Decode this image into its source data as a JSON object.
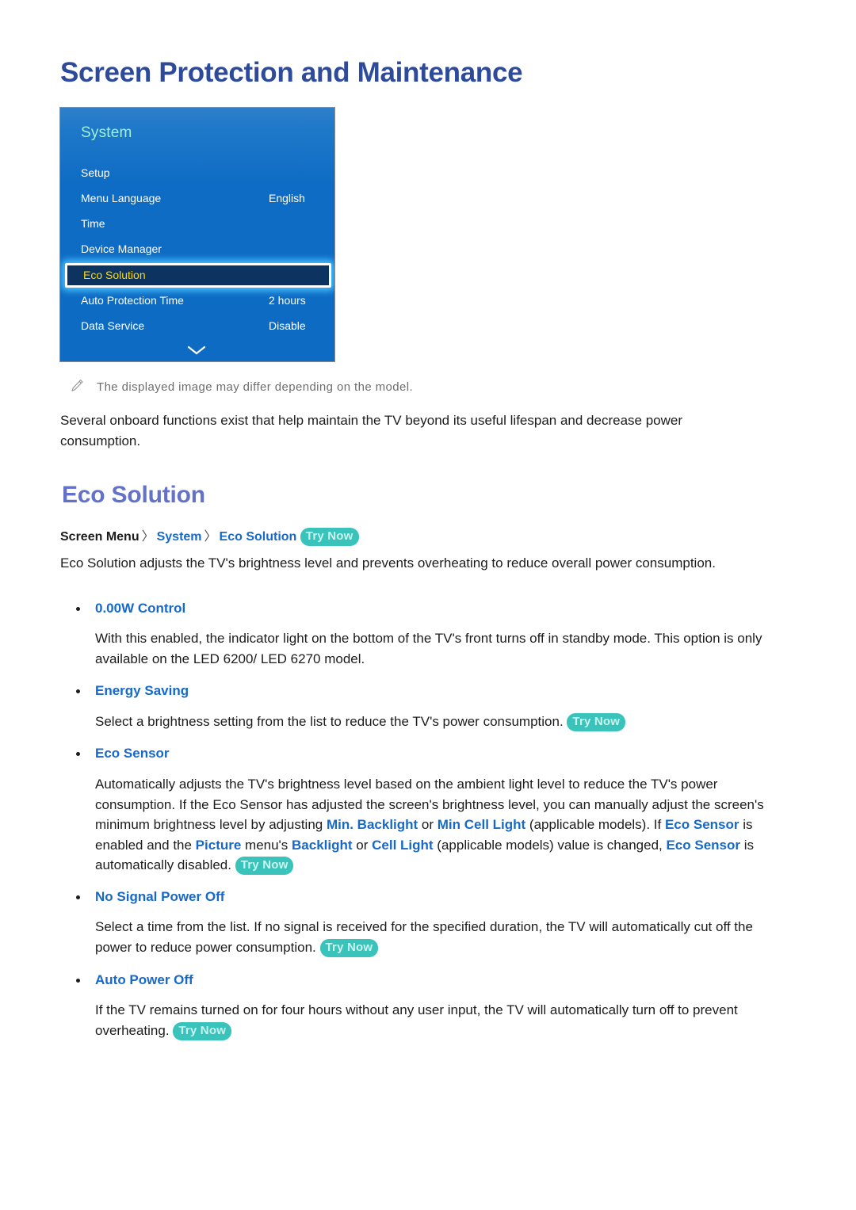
{
  "page_title": "Screen Protection and Maintenance",
  "tv_menu": {
    "header": "System",
    "rows": [
      {
        "label": "Setup",
        "value": ""
      },
      {
        "label": "Menu Language",
        "value": "English"
      },
      {
        "label": "Time",
        "value": ""
      },
      {
        "label": "Device Manager",
        "value": ""
      },
      {
        "label": "Eco Solution",
        "value": "",
        "selected": true
      },
      {
        "label": "Auto Protection Time",
        "value": "2 hours"
      },
      {
        "label": "Data Service",
        "value": "Disable"
      }
    ],
    "scroll_icon": "chevron-down-icon",
    "colors": {
      "panel_blue": "#0d6bc4",
      "header_text": "#9ff0da",
      "selected_fill": "#0d3460",
      "selected_text": "#ffd900",
      "selected_glow": "#49c2ff"
    }
  },
  "note": {
    "icon": "pencil-icon",
    "text": "The displayed image may differ depending on the model."
  },
  "intro_paragraph": "Several onboard functions exist that help maintain the TV beyond its useful lifespan and decrease power consumption.",
  "section": {
    "title": "Eco Solution",
    "breadcrumb": {
      "root": "Screen Menu",
      "separator": "〉",
      "level1": "System",
      "level2": "Eco Solution",
      "badge": "Try Now"
    },
    "description": "Eco Solution adjusts the TV's brightness level and prevents overheating to reduce overall power consumption."
  },
  "features": [
    {
      "title": "0.00W Control",
      "body": "With this enabled, the indicator light on the bottom of the TV's front turns off in standby mode. This option is only available on the LED 6200/ LED 6270 model.",
      "badge": ""
    },
    {
      "title": "Energy Saving",
      "body": "Select a brightness setting from the list to reduce the TV's power consumption.",
      "badge": "Try Now"
    },
    {
      "title": "Eco Sensor",
      "body_parts": [
        {
          "t": "Automatically adjusts the TV's brightness level based on the ambient light level to reduce the TV's power consumption. If the Eco Sensor has adjusted the screen's brightness level, you can manually adjust the screen's minimum brightness level by adjusting ",
          "b": false
        },
        {
          "t": "Min. Backlight",
          "b": true
        },
        {
          "t": " or ",
          "b": false
        },
        {
          "t": "Min Cell Light",
          "b": true
        },
        {
          "t": " (applicable models). If ",
          "b": false
        },
        {
          "t": "Eco Sensor",
          "b": true
        },
        {
          "t": " is enabled and the ",
          "b": false
        },
        {
          "t": "Picture",
          "b": true
        },
        {
          "t": " menu's ",
          "b": false
        },
        {
          "t": "Backlight",
          "b": true
        },
        {
          "t": " or ",
          "b": false
        },
        {
          "t": "Cell Light",
          "b": true
        },
        {
          "t": " (applicable models) value is changed, ",
          "b": false
        },
        {
          "t": "Eco Sensor",
          "b": true
        },
        {
          "t": " is automatically disabled. ",
          "b": false
        }
      ],
      "badge": "Try Now"
    },
    {
      "title": "No Signal Power Off",
      "body": "Select a time from the list. If no signal is received for the specified duration, the TV will automatically cut off the power to reduce power consumption.",
      "badge": "Try Now"
    },
    {
      "title": "Auto Power Off",
      "body": "If the TV remains turned on for four hours without any user input, the TV will automatically turn off to prevent overheating.",
      "badge": "Try Now"
    }
  ],
  "colors": {
    "page_title": "#2d4a9b",
    "section_title": "#6272c9",
    "link_blue": "#1669c9",
    "badge_bg": "#3ac3bb",
    "badge_text": "#caf4ef",
    "note_gray": "#6e6e6e"
  }
}
